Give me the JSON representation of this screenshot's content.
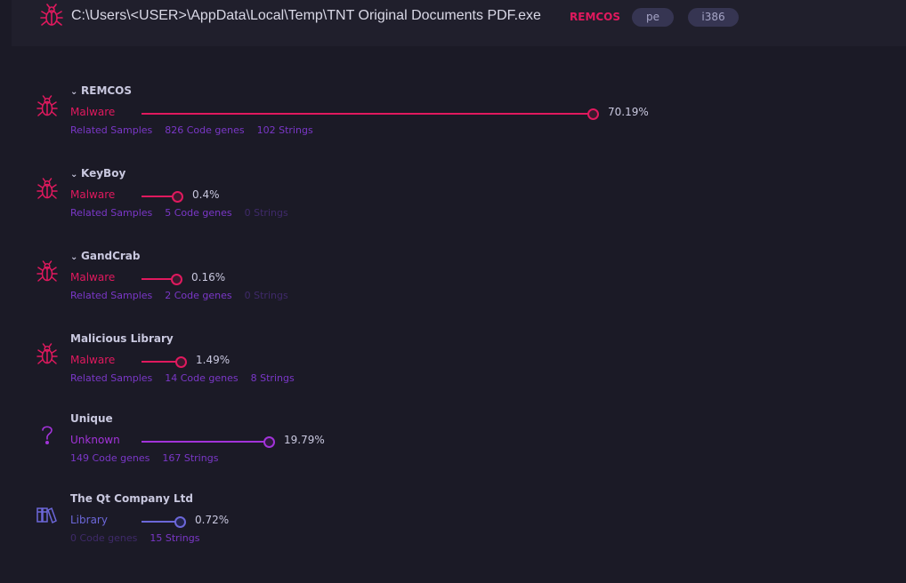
{
  "header": {
    "path": "C:\\Users\\<USER>\\AppData\\Local\\Temp\\TNT Original Documents PDF.exe",
    "family": "REMCOS",
    "tags": [
      "pe",
      "i386"
    ],
    "icon": "bug-icon"
  },
  "colors": {
    "malware": "#e0195e",
    "unknown": "#a233d9",
    "library": "#6c67d9",
    "link": "#7a37c7",
    "link_dim": "#3f2a6a"
  },
  "entries": [
    {
      "title": "REMCOS",
      "collapsible": true,
      "kind": "Malware",
      "icon": "bug-icon",
      "percent_label": "70.19%",
      "percent": 70.19,
      "related_samples": "Related Samples",
      "code_genes": "826 Code genes",
      "strings": "102 Strings"
    },
    {
      "title": "KeyBoy",
      "collapsible": true,
      "kind": "Malware",
      "icon": "bug-icon",
      "percent_label": "0.4%",
      "percent": 0.4,
      "related_samples": "Related Samples",
      "code_genes": "5 Code genes",
      "strings": "0 Strings"
    },
    {
      "title": "GandCrab",
      "collapsible": true,
      "kind": "Malware",
      "icon": "bug-icon",
      "percent_label": "0.16%",
      "percent": 0.16,
      "related_samples": "Related Samples",
      "code_genes": "2 Code genes",
      "strings": "0 Strings"
    },
    {
      "title": "Malicious Library",
      "collapsible": false,
      "kind": "Malware",
      "icon": "bug-icon",
      "percent_label": "1.49%",
      "percent": 1.49,
      "related_samples": "Related Samples",
      "code_genes": "14 Code genes",
      "strings": "8 Strings"
    },
    {
      "title": "Unique",
      "collapsible": false,
      "kind": "Unknown",
      "icon": "question-icon",
      "percent_label": "19.79%",
      "percent": 19.79,
      "code_genes": "149 Code genes",
      "strings": "167 Strings"
    },
    {
      "title": "The Qt Company Ltd",
      "collapsible": false,
      "kind": "Library",
      "icon": "library-books-icon",
      "percent_label": "0.72%",
      "percent": 0.72,
      "code_genes": "0 Code genes",
      "strings": "15 Strings"
    }
  ]
}
